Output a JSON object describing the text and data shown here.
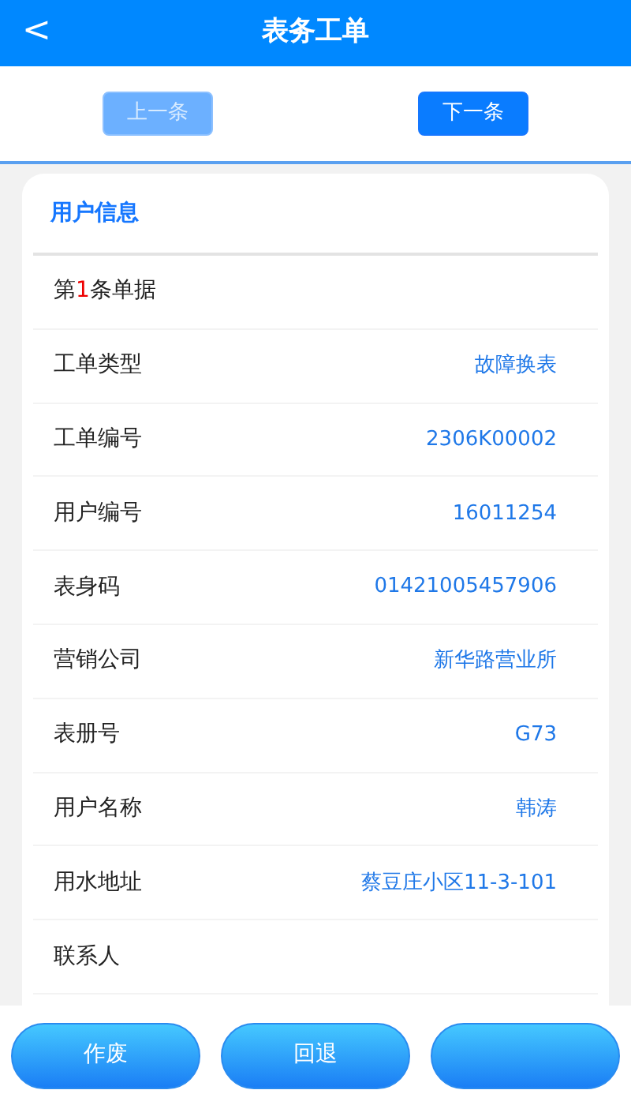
{
  "header": {
    "back_icon": "<",
    "title": "表务工单"
  },
  "pager": [
    {
      "label": "上一条",
      "disabled": true
    },
    {
      "label": "下一条",
      "disabled": false
    }
  ],
  "section": {
    "title": "用户信息"
  },
  "record": {
    "prefix": "第",
    "index": "1",
    "suffix": "条单据"
  },
  "fields": [
    {
      "label": "工单类型",
      "value": "故障换表"
    },
    {
      "label": "工单编号",
      "value": "2306K00002"
    },
    {
      "label": "用户编号",
      "value": "16011254"
    },
    {
      "label": "表身码",
      "value": "01421005457906"
    },
    {
      "label": "营销公司",
      "value": "新华路营业所"
    },
    {
      "label": "表册号",
      "value": "G73"
    },
    {
      "label": "用户名称",
      "value": "韩涛"
    },
    {
      "label": "用水地址",
      "value": "蔡豆庄小区11-3-101"
    },
    {
      "label": "联系人"
    }
  ],
  "actions": [
    {
      "kind": "labeled",
      "label": "作废"
    },
    {
      "kind": "labeled",
      "label": "回退"
    },
    {
      "kind": "covered"
    }
  ]
}
